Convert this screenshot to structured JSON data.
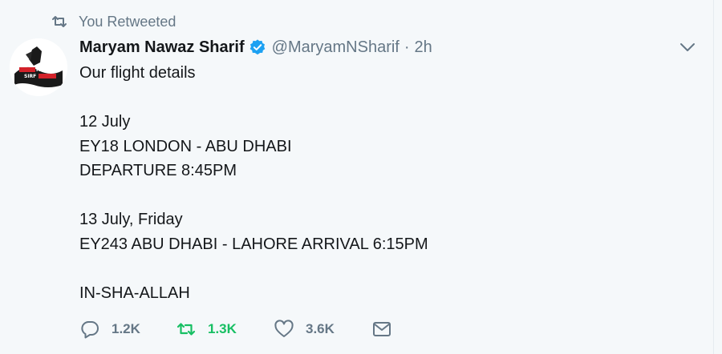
{
  "retweet_context": {
    "text": "You Retweeted",
    "icon": "retweet-icon"
  },
  "author": {
    "name": "Maryam Nawaz Sharif",
    "handle": "@MaryamNSharif",
    "separator": "·",
    "time": "2h",
    "verified": true,
    "avatar_text_1": "FAISLA",
    "avatar_text_2": "SIRF"
  },
  "tweet": {
    "lines": [
      "Our flight details",
      "",
      "12 July",
      "EY18 LONDON - ABU DHABI",
      "DEPARTURE 8:45PM",
      "",
      "13 July, Friday",
      "EY243 ABU DHABI - LAHORE ARRIVAL 6:15PM",
      "",
      "IN-SHA-ALLAH"
    ]
  },
  "actions": {
    "reply_count": "1.2K",
    "retweet_count": "1.3K",
    "like_count": "3.6K"
  },
  "colors": {
    "background": "#f5f8fa",
    "text": "#14171a",
    "secondary": "#657786",
    "verified": "#1da1f2",
    "retweeted": "#17bf63"
  }
}
